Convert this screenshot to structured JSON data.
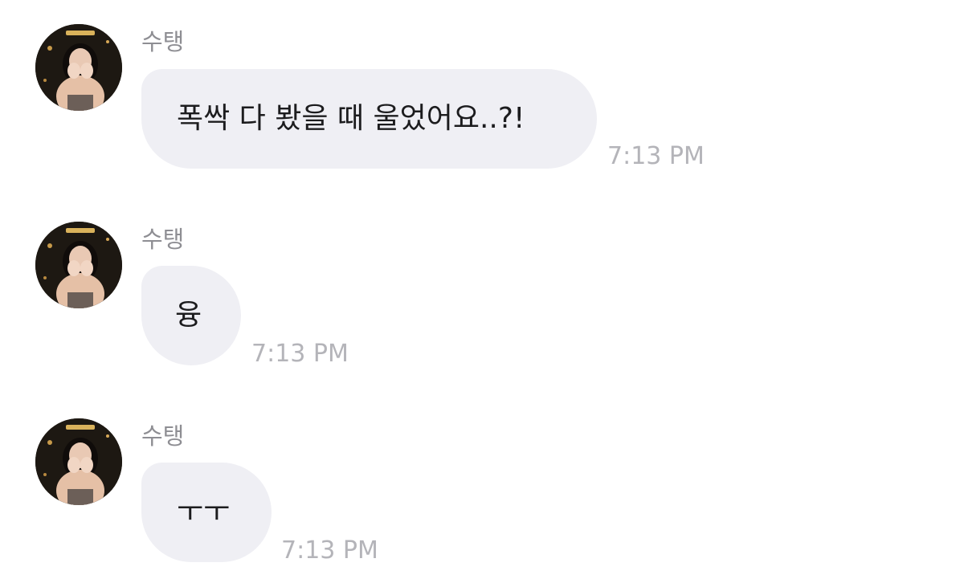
{
  "messages": [
    {
      "sender": "수탱",
      "text": "폭싹 다 봤을 때 울었어요..?!",
      "time": "7:13 PM",
      "avatar": "profile-photo"
    },
    {
      "sender": "수탱",
      "text": "융",
      "time": "7:13 PM",
      "avatar": "profile-photo"
    },
    {
      "sender": "수탱",
      "text": "ㅜㅜ",
      "time": "7:13 PM",
      "avatar": "profile-photo"
    }
  ],
  "colors": {
    "bubble": "#efeff4",
    "sender": "#8e8e93",
    "time": "#b4b4b9",
    "text": "#1c1c1e"
  }
}
